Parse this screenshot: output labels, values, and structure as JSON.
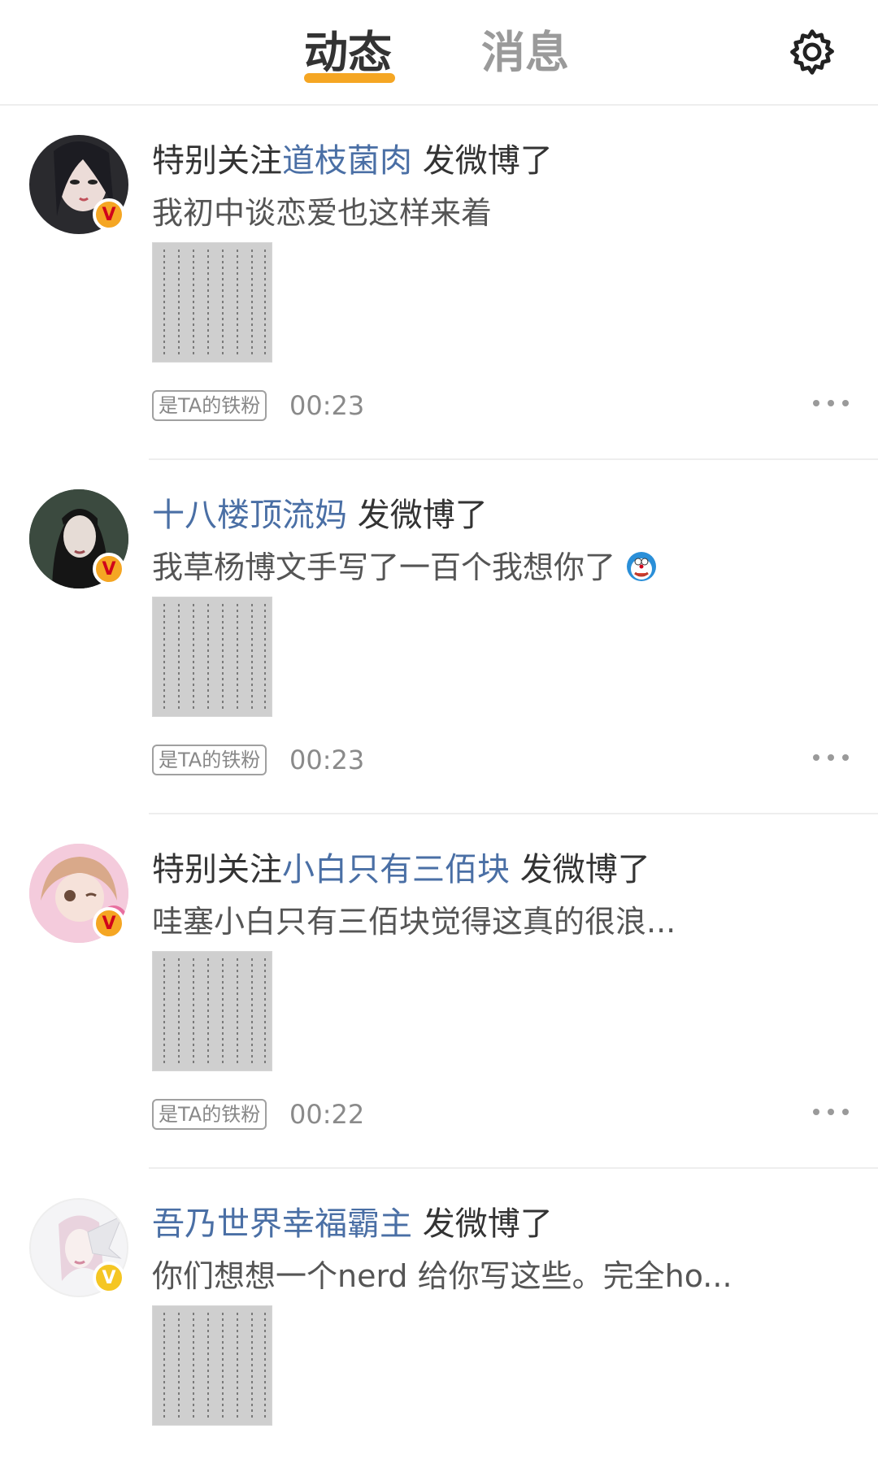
{
  "tabs": {
    "active": "动态",
    "inactive": "消息"
  },
  "icons": {
    "settings": "gear-icon",
    "more": "more-dots-icon",
    "verified": "verified-v-icon"
  },
  "colors": {
    "accent": "#f5a623",
    "username": "#4a6fa5",
    "text": "#333333",
    "muted": "#8a8a8a"
  },
  "feed": [
    {
      "prefix": "特别关注",
      "username": "道枝菌肉",
      "action": " 发微博了",
      "text": "我初中谈恋爱也这样来着",
      "tag": "是TA的铁粉",
      "time": "00:23",
      "badge": "V"
    },
    {
      "prefix": "",
      "username": "十八楼顶流妈",
      "action": " 发微博了",
      "text": "我草杨博文手写了一百个我想你了",
      "tag": "是TA的铁粉",
      "time": "00:23",
      "badge": "V"
    },
    {
      "prefix": "特别关注",
      "username": "小白只有三佰块",
      "action": " 发微博了",
      "text": "哇塞小白只有三佰块觉得这真的很浪...",
      "tag": "是TA的铁粉",
      "time": "00:22",
      "badge": "V"
    },
    {
      "prefix": "",
      "username": "吾乃世界幸福霸主",
      "action": " 发微博了",
      "text": "你们想想一个nerd 给你写这些。完全ho...",
      "tag": "",
      "time": "",
      "badge": "V"
    }
  ]
}
